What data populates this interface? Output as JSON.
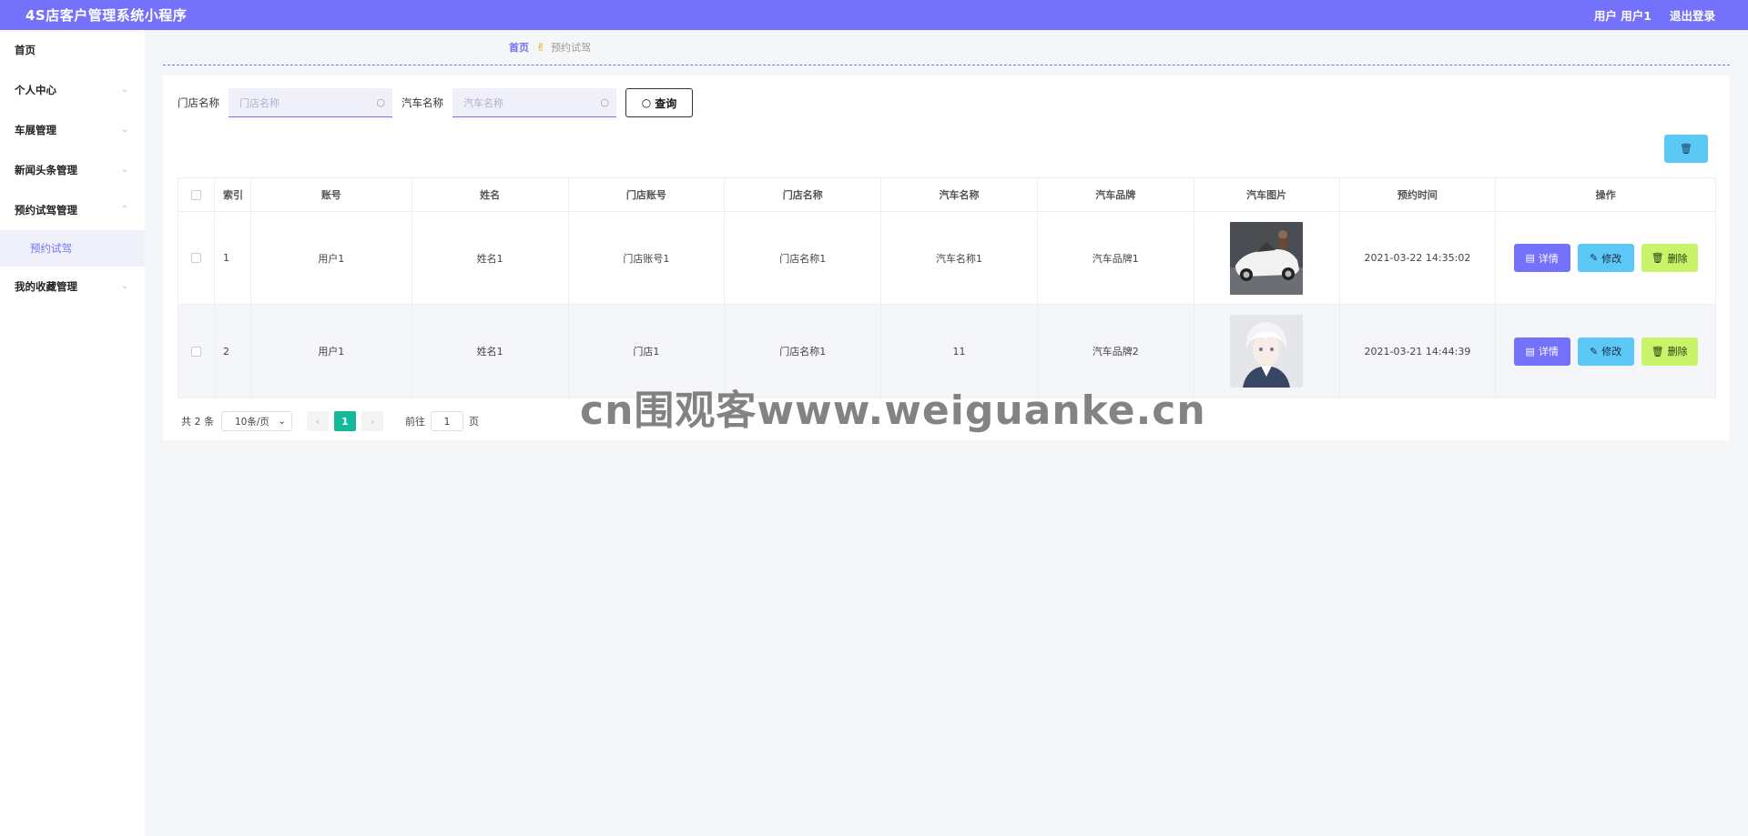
{
  "header": {
    "title": "4S店客户管理系统小程序",
    "user_label": "用户 用户1",
    "logout_label": "退出登录"
  },
  "sidebar": {
    "items": [
      {
        "label": "首页"
      },
      {
        "label": "个人中心"
      },
      {
        "label": "车展管理"
      },
      {
        "label": "新闻头条管理"
      },
      {
        "label": "预约试驾管理"
      },
      {
        "label": "预约试驾"
      },
      {
        "label": "我的收藏管理"
      }
    ]
  },
  "breadcrumb": {
    "home": "首页",
    "current": "预约试驾"
  },
  "search": {
    "store_label": "门店名称",
    "store_placeholder": "门店名称",
    "car_label": "汽车名称",
    "car_placeholder": "汽车名称",
    "query_label": "查询"
  },
  "table": {
    "headers": [
      "索引",
      "账号",
      "姓名",
      "门店账号",
      "门店名称",
      "汽车名称",
      "汽车品牌",
      "汽车图片",
      "预约时间",
      "操作"
    ],
    "rows": [
      {
        "index": "1",
        "account": "用户1",
        "name": "姓名1",
        "store_account": "门店账号1",
        "store_name": "门店名称1",
        "car_name": "汽车名称1",
        "car_brand": "汽车品牌1",
        "time": "2021-03-22 14:35:02"
      },
      {
        "index": "2",
        "account": "用户1",
        "name": "姓名1",
        "store_account": "门店1",
        "store_name": "门店名称1",
        "car_name": "11",
        "car_brand": "汽车品牌2",
        "time": "2021-03-21 14:44:39"
      }
    ],
    "actions": {
      "detail": "详情",
      "edit": "修改",
      "delete": "删除"
    }
  },
  "pagination": {
    "total": "共 2 条",
    "page_size": "10条/页",
    "current_page": "1",
    "goto_prefix": "前往",
    "goto_value": "1",
    "goto_suffix": "页"
  },
  "watermark": "cn围观客www.weiguanke.cn",
  "colors": {
    "primary": "#7472fb",
    "edit": "#5cc8f5",
    "delete": "#c9f46a",
    "page_active": "#16b89a"
  }
}
